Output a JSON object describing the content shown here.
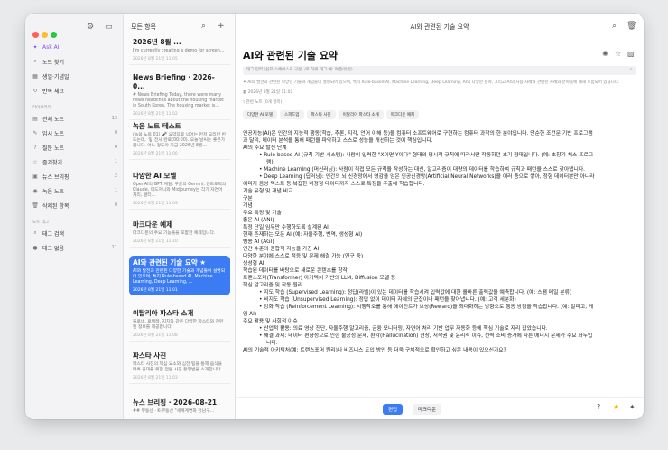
{
  "window": {
    "title": "AI와 관련된 기술 요약"
  },
  "sidebar": {
    "items": [
      {
        "label": "Ask AI",
        "icon": "sparkle-icon",
        "count": ""
      },
      {
        "label": "노트 찾기",
        "icon": "search-icon",
        "count": ""
      },
      {
        "label": "생일·기념일",
        "icon": "calendar-icon",
        "count": ""
      },
      {
        "label": "반복 체크",
        "icon": "repeat-icon",
        "count": ""
      }
    ],
    "section_library": "라이브러리",
    "library": [
      {
        "label": "전체 노트",
        "icon": "notes-icon",
        "count": "13"
      },
      {
        "label": "임시 노트",
        "icon": "draft-icon",
        "count": "0"
      },
      {
        "label": "질문 노트",
        "icon": "question-icon",
        "count": "0"
      },
      {
        "label": "즐겨찾기",
        "icon": "star-icon",
        "count": "1"
      },
      {
        "label": "뉴스 브리핑",
        "icon": "news-icon",
        "count": "2"
      },
      {
        "label": "녹음 노트",
        "icon": "mic-icon",
        "count": "1"
      },
      {
        "label": "삭제된 항목",
        "icon": "trash-icon",
        "count": "0"
      }
    ],
    "section_tags": "노트 태그",
    "tags": [
      {
        "label": "태그 검색",
        "icon": "search-icon",
        "count": ""
      },
      {
        "label": "태그 없음",
        "icon": "tag-icon",
        "count": "11"
      }
    ]
  },
  "list": {
    "header": "모든 항목",
    "cards": [
      {
        "title": "2026년 8월 ...",
        "preview": "I'm currently creating a demo for screen...",
        "date": "2026년 8월 21일 11:05"
      },
      {
        "title": "News Briefing · 2026-0...",
        "preview": "# News Briefing Today, there were many news headlines about the housing market in South Korea. The housing market is...",
        "date": "2026년 8월 21일 11:02"
      },
      {
        "title": "녹음 노트 테스트",
        "preview": "(녹음 노트 01) 🎤 요약으로 넘어는 먼저 오리만 반드는데, 🎙 전사 완료(00:00). 오늘 날씨는 좋은가 봅니다. 어느 정도야 지금 2026년 8월...",
        "date": "2026년 8월 21일 11:00"
      },
      {
        "title": "다양한 AI 모델",
        "preview": "OpenAI의 GPT 계열, 구글의 Gemini, 앤트로픽의 Claude, 미드저니와 Midjourney는 각기 자연어 처리, 멀티...",
        "date": "2026년 8월 21일 11:09"
      },
      {
        "title": "마크다운 예제",
        "preview": "마크다운의 주요 기능들을 포함한 예제입니다.",
        "date": "2026년 8월 21일 11:10"
      },
      {
        "title": "AI와 관련된 기술 요약 ★",
        "preview": "AI와 발전과 관련된 다양한 기술과 개념들이 설명되어 있으며, 특히 Rule-based AI, Machine Learning, Deep Learning, ...",
        "date": "2026년 8월 21일 11:01"
      },
      {
        "title": "이탈리아 파스타 소개",
        "preview": "볼로네, 로텔레, 지치와 같은 다양한 파스타와 관련된 정보를 제공합니다.",
        "date": "2026년 8월 21일 11:08"
      },
      {
        "title": "파스타 사진",
        "preview": "파스타 사진의 핵심 요소와 심전 팁을 통해 음식을 매혹 출대를 위한 전문 사진 촬영법을 소개합니다.",
        "date": "2026년 8월 21일 11:03"
      },
      {
        "title": "뉴스 브리핑 · 2026-08-21",
        "preview": "## 부동산 · K-부동산 \"세계계변화 강남구...",
        "date": ""
      }
    ]
  },
  "doc": {
    "title": "AI와 관련된 기술 요약",
    "tag_placeholder": "태그 입력 (쉼표·스페이스로 구분, /로 하위 태그 예: 여행/유럽)",
    "summary": "AI의 발전과 관련된 다양한 기술과 개념들이 설명되어 있으며, 특히 Rule-based AI, Machine Learning, Deep Learning, AI의 다양한 분야, 그리고 AI의 사용 사례와 관련된 사례와 분야들에 대해 포함되어 있습니다.",
    "date": "2026년 8월 21일 11:01",
    "related": "관련 노트 (0개 항목)",
    "chips": [
      "다양한 AI 모델",
      "스피드업",
      "파스타 사진",
      "이탈리아 파스타 소개",
      "마크다운 예제"
    ],
    "lines": [
      {
        "text": "인공지능(AI)은 인간의 지능적 행동(학습, 추론, 지각, 언어 이해 등)을 컴퓨터 소프트웨어로 구현하는 컴퓨터 과학의 한 분야입니다. 단순한 조건문 기반 프로그램",
        "style": ""
      },
      {
        "text": "과 달리, 데이터 분석을 통해 패턴을 파악하고 스스로 성능을 개선하는 것이 핵심입니다.",
        "style": ""
      },
      {
        "text": "AI의 주요 발전 단계",
        "style": ""
      },
      {
        "text": "•    Rule-based AI (규칙 기반 시스템): 사람이 입력한 \"X이면 Y이다\" 형태의 명시적 규칙에 따라서만 작동하던 초기 형태입니다. (예: 초창기 체스 프로그",
        "style": "b1"
      },
      {
        "text": "램)",
        "style": "b2"
      },
      {
        "text": "•    Machine Learning (머신러닝): 사람이 직접 모든 규칙을 작성하는 대신, 알고리즘이 대량의 데이터를 학습하여 규칙과 패턴을 스스로 찾아냅니다.",
        "style": "b1"
      },
      {
        "text": "•    Deep Learning (딥러닝): 인간의 뇌 신경망에서 영감을 얻은 인공신경망(Artificial Neural Networks)을 여러 층으로 쌓아, 정형 데이터뿐만 아니라",
        "style": "b1"
      },
      {
        "text": "이미지·음성·텍스트 등 복잡한 비정형 데이터까지 스스로 특징을 추출해 학습합니다.",
        "style": ""
      },
      {
        "text": "기술 유형 및 개념 비교",
        "style": ""
      },
      {
        "text": "구분",
        "style": ""
      },
      {
        "text": "개념",
        "style": ""
      },
      {
        "text": "주요 특징 및 기술",
        "style": ""
      },
      {
        "text": "좁은 AI (ANI)",
        "style": ""
      },
      {
        "text": "특정 단일 임무만 수행하도록 설계된 AI",
        "style": ""
      },
      {
        "text": "현재 존재하는 모든 AI (예: 자율주행, 번역, 생성형 AI)",
        "style": ""
      },
      {
        "text": "범용 AI (AGI)",
        "style": ""
      },
      {
        "text": "인간 수준의 종합적 지능을 가진 AI",
        "style": ""
      },
      {
        "text": "다양한 분야에 스스로 적응 및 문제 해결 가능 (연구 중)",
        "style": ""
      },
      {
        "text": "생성형 AI",
        "style": ""
      },
      {
        "text": "학습된 데이터를 바탕으로 새로운 콘텐츠를 창작",
        "style": ""
      },
      {
        "text": "트랜스포머(Transformer) 아키텍처 기반의 LLM, Diffusion 모델 등",
        "style": ""
      },
      {
        "text": "핵심 알고리즘 및 작동 원리",
        "style": ""
      },
      {
        "text": "•    지도 학습 (Supervised Learning): 정답(라벨)이 있는 데이터를 학습시켜 입력값에 대한 올바른 출력값을 예측합니다. (예: 스팸 메일 분류)",
        "style": "b1"
      },
      {
        "text": "•    비지도 학습 (Unsupervised Learning): 정답 없이 데이터 자체의 군집이나 패턴을 찾아냅니다. (예: 고객 세분화)",
        "style": "b1"
      },
      {
        "text": "•    강화 학습 (Reinforcement Learning): 시행착오를 통해 에이전트가 보상(Reward)을 최대화하는 방향으로 행동 방침을 학습합니다. (예: 알파고, 게",
        "style": "b1"
      },
      {
        "text": "임 AI)",
        "style": ""
      },
      {
        "text": "주요 활용 및 사회적 이슈",
        "style": ""
      },
      {
        "text": "•    산업적 활용: 의료 영상 진단, 자율주행 알고리즘, 금융 모니터링, 자연어 처리 기반 업무 자동화 등에 핵심 기술로 자리 잡았습니다.",
        "style": "b1"
      },
      {
        "text": "•    해결 과제: 데이터 편향성으로 인한 불공정 문제, 환각(Hallucination) 현상, 저작권 및 윤리적 이슈, 전력 소비 증가에 따른 에너지 문제가 주요 화두입",
        "style": "b1"
      },
      {
        "text": "니다.",
        "style": "b2"
      },
      {
        "text": "AI의 기술적 아키텍처(예: 트랜스포머 원리)나 비즈니스 도입 방안 등 더욱 구체적으로 확인하고 싶은 내용이 있으신가요?",
        "style": ""
      }
    ]
  },
  "bottom": {
    "edit_label": "편집",
    "markdown_label": "마크다운"
  },
  "colors": {
    "accent": "#3b7bf3",
    "ask_ai": "#8a4ff0"
  }
}
